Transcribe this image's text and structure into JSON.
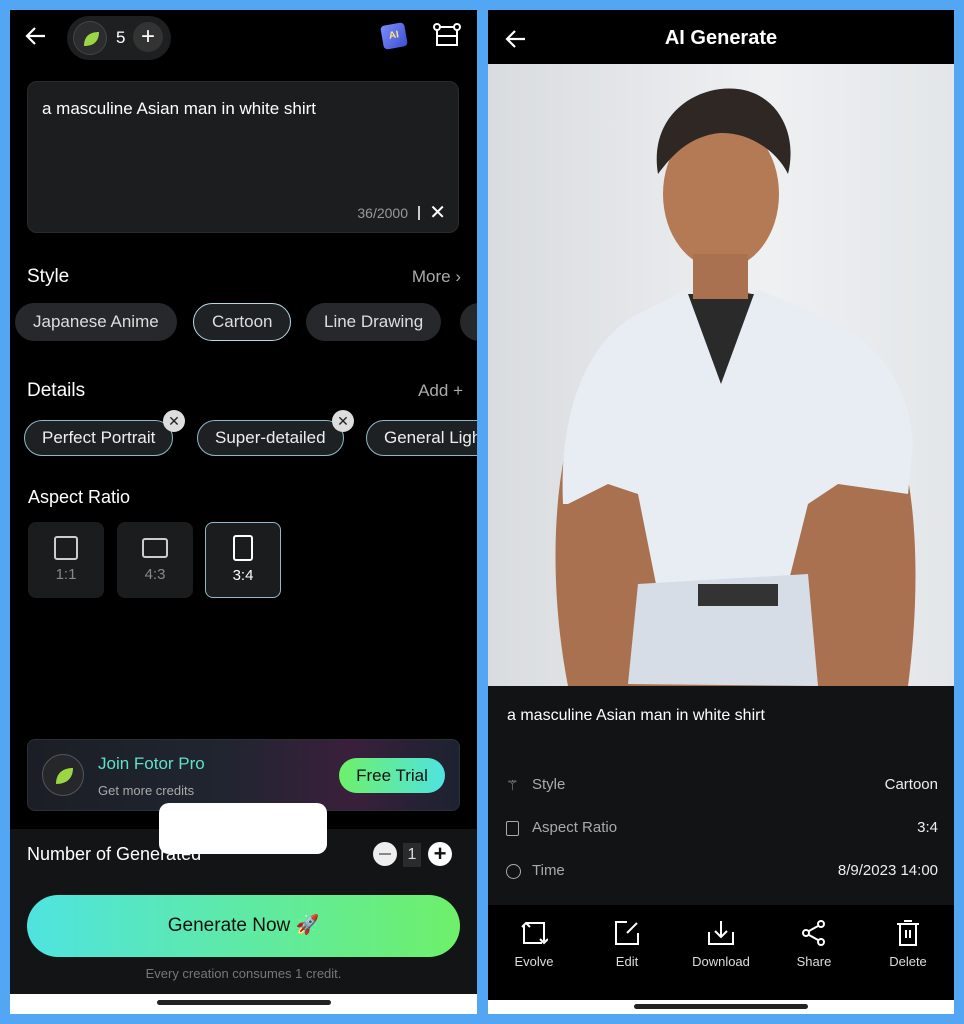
{
  "left": {
    "credits": "5",
    "prompt": "a masculine Asian man in white shirt",
    "char_count": "36/2000",
    "style": {
      "title": "Style",
      "more": "More",
      "options": [
        "Japanese Anime",
        "Cartoon",
        "Line Drawing"
      ],
      "selected": "Cartoon"
    },
    "details": {
      "title": "Details",
      "add": "Add",
      "options": [
        "Perfect Portrait",
        "Super-detailed",
        "General Lighting"
      ]
    },
    "aspect": {
      "title": "Aspect Ratio",
      "options": [
        "1:1",
        "4:3",
        "3:4"
      ],
      "selected": "3:4"
    },
    "promo": {
      "title": "Join Fotor Pro",
      "subtitle": "Get more credits",
      "button": "Free Trial"
    },
    "number": {
      "label": "Number of Generated",
      "value": "1"
    },
    "generate": "Generate Now 🚀",
    "footnote": "Every creation consumes 1 credit."
  },
  "right": {
    "title": "AI Generate",
    "prompt": "a masculine Asian man in white shirt",
    "meta": [
      {
        "label": "Style",
        "value": "Cartoon"
      },
      {
        "label": "Aspect Ratio",
        "value": "3:4"
      },
      {
        "label": "Time",
        "value": "8/9/2023 14:00"
      }
    ],
    "actions": [
      "Evolve",
      "Edit",
      "Download",
      "Share",
      "Delete"
    ]
  },
  "colors": {
    "background": "#52a6f4",
    "accent_gradient_start": "#4fe3e0",
    "accent_gradient_end": "#6ef06a",
    "promo_title": "#5fe0c8"
  }
}
